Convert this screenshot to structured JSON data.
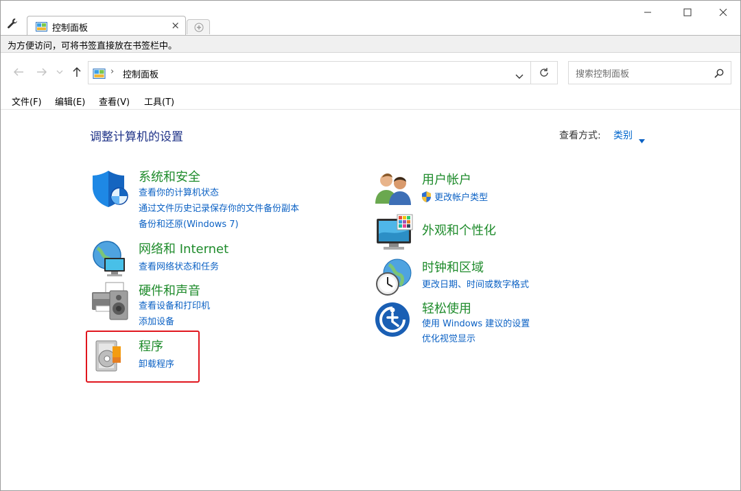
{
  "tab": {
    "title": "控制面板",
    "close": "×"
  },
  "hint_bar": {
    "text": "为方便访问，可将书签直接放在书签栏中。"
  },
  "address": {
    "separator": "›",
    "location": "控制面板",
    "search_placeholder": "搜索控制面板"
  },
  "menu": {
    "file": "文件(F)",
    "edit": "编辑(E)",
    "view": "查看(V)",
    "tools": "工具(T)"
  },
  "page": {
    "heading": "调整计算机的设置",
    "view_by_label": "查看方式:",
    "view_by_value": "类别"
  },
  "categories": [
    {
      "title": "系统和安全",
      "icon": "shield-icon",
      "links": [
        "查看你的计算机状态",
        "通过文件历史记录保存你的文件备份副本",
        "备份和还原(Windows 7)"
      ]
    },
    {
      "title": "网络和 Internet",
      "icon": "network-globe-icon",
      "links": [
        "查看网络状态和任务"
      ]
    },
    {
      "title": "硬件和声音",
      "icon": "printer-speaker-icon",
      "links": [
        "查看设备和打印机",
        "添加设备"
      ]
    },
    {
      "title": "程序",
      "icon": "programs-disc-icon",
      "links": [
        "卸载程序"
      ]
    },
    {
      "title": "用户帐户",
      "icon": "users-icon",
      "links": [
        "更改帐户类型"
      ]
    },
    {
      "title": "外观和个性化",
      "icon": "monitor-palette-icon",
      "links": []
    },
    {
      "title": "时钟和区域",
      "icon": "clock-globe-icon",
      "links": [
        "更改日期、时间或数字格式"
      ]
    },
    {
      "title": "轻松使用",
      "icon": "ease-of-access-icon",
      "links": [
        "使用 Windows 建议的设置",
        "优化视觉显示"
      ]
    }
  ],
  "colors": {
    "category_title": "#1e8b2b",
    "link": "#0b61c4",
    "heading": "#1e3287",
    "highlight": "#e0141c"
  }
}
